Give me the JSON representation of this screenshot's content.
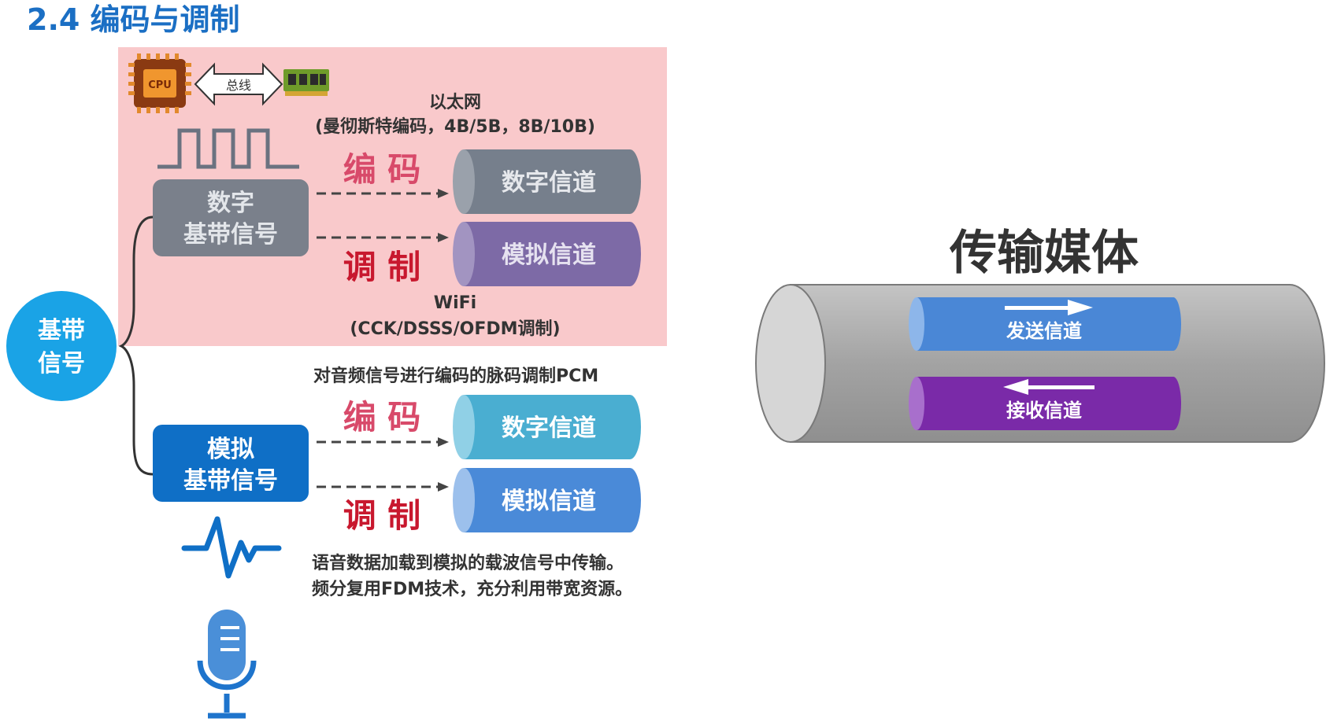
{
  "title": "2.4 编码与调制",
  "baseband": {
    "line1": "基带",
    "line2": "信号"
  },
  "top_section": {
    "bus_label": "总线",
    "cpu_label": "CPU",
    "ethernet_title": "以太网",
    "ethernet_detail": "(曼彻斯特编码，4B/5B，8B/10B)",
    "digital_baseband": {
      "line1": "数字",
      "line2": "基带信号"
    },
    "encode_label": "编 码",
    "modulate_label": "调 制",
    "digital_channel": "数字信道",
    "analog_channel": "模拟信道",
    "wifi_title": "WiFi",
    "wifi_detail": "(CCK/DSSS/OFDM调制)"
  },
  "bottom_section": {
    "pcm_note": "对音频信号进行编码的脉码调制PCM",
    "analog_baseband": {
      "line1": "模拟",
      "line2": "基带信号"
    },
    "encode_label": "编 码",
    "modulate_label": "调 制",
    "digital_channel": "数字信道",
    "analog_channel": "模拟信道",
    "carrier_note_1": "语音数据加载到模拟的载波信号中传输。",
    "carrier_note_2": "频分复用FDM技术，充分利用带宽资源。"
  },
  "media": {
    "title": "传输媒体",
    "send_channel": "发送信道",
    "receive_channel": "接收信道"
  },
  "icons": {
    "cpu": "cpu-chip-icon",
    "memory": "memory-module-icon",
    "bus": "bus-double-arrow-icon",
    "square_wave": "square-wave-icon",
    "analog_wave": "analog-waveform-icon",
    "microphone": "microphone-icon"
  },
  "colors": {
    "title_blue": "#1b6fc4",
    "pink_panel": "#f9c9cb",
    "digital_box": "#7a808b",
    "analog_box": "#0f6fc6",
    "baseband_circle": "#1aa3e6",
    "digital_channel_top": "#767f8c",
    "analog_channel_top": "#7d6aa6",
    "digital_channel_bottom": "#4aaed1",
    "analog_channel_bottom": "#4a8ad8",
    "red_text": "#c8182e",
    "send_channel": "#4a87d6",
    "receive_channel": "#7a2aa8",
    "media_tube": "#a7a7a7"
  }
}
